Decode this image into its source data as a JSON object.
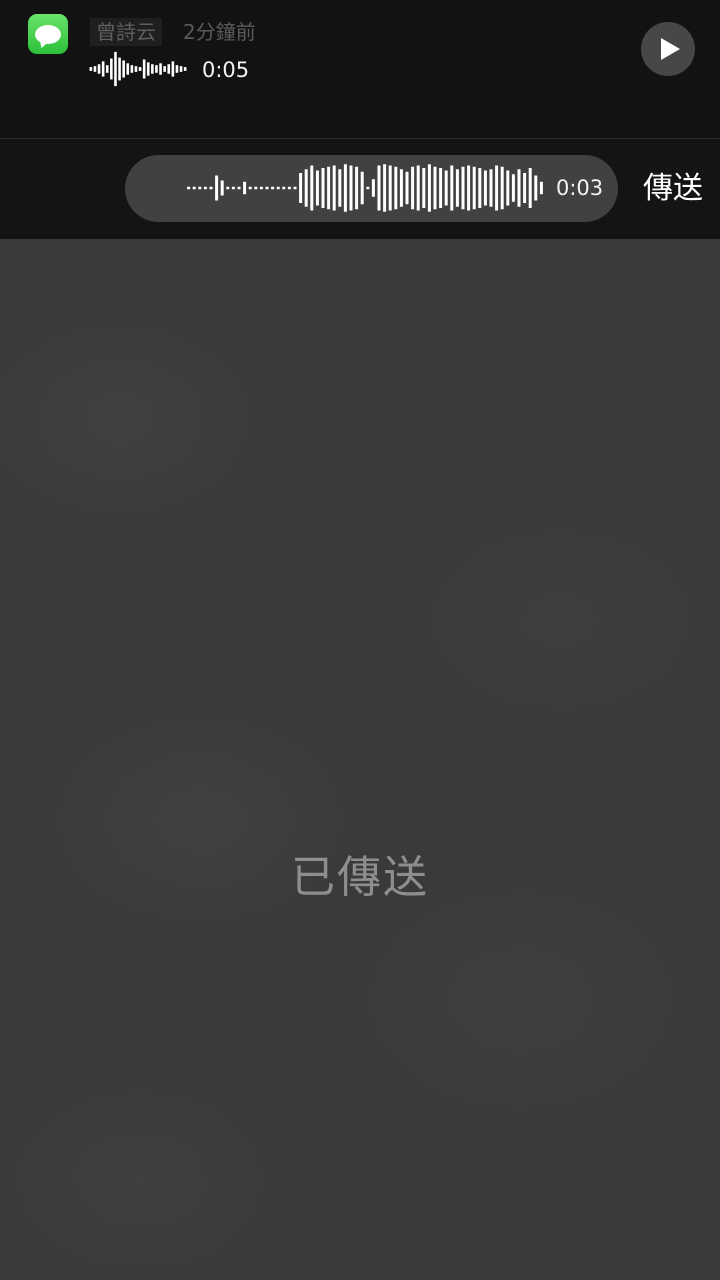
{
  "notification": {
    "app_icon": "messages-app-icon",
    "sender": "曾詩云",
    "time_ago": "2分鐘前",
    "voice_message": {
      "duration": "0:05",
      "waveform": [
        0.1,
        0.15,
        0.25,
        0.4,
        0.2,
        0.55,
        0.9,
        0.6,
        0.45,
        0.3,
        0.2,
        0.15,
        0.1,
        0.5,
        0.35,
        0.25,
        0.2,
        0.3,
        0.15,
        0.25,
        0.4,
        0.2,
        0.15,
        0.1
      ]
    },
    "play_icon": "play-icon"
  },
  "reply_bar": {
    "voice_message": {
      "duration": "0:03",
      "waveform": [
        0.05,
        0.05,
        0.05,
        0.05,
        0.05,
        0.5,
        0.3,
        0.05,
        0.05,
        0.05,
        0.25,
        0.05,
        0.05,
        0.05,
        0.05,
        0.05,
        0.05,
        0.05,
        0.05,
        0.05,
        0.6,
        0.75,
        0.9,
        0.7,
        0.8,
        0.85,
        0.9,
        0.75,
        0.95,
        0.9,
        0.85,
        0.65,
        0.05,
        0.35,
        0.9,
        0.95,
        0.9,
        0.85,
        0.75,
        0.65,
        0.85,
        0.9,
        0.8,
        0.95,
        0.85,
        0.8,
        0.7,
        0.9,
        0.75,
        0.85,
        0.9,
        0.85,
        0.8,
        0.7,
        0.75,
        0.9,
        0.85,
        0.7,
        0.55,
        0.75,
        0.6,
        0.8,
        0.5,
        0.25
      ]
    },
    "send_label": "傳送"
  },
  "status": {
    "sent_label": "已傳送"
  }
}
